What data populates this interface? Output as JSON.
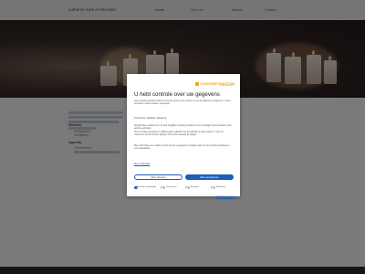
{
  "site": {
    "brand": "Lutherse Kerk Amsterdam",
    "nav": [
      "Home",
      "Over ons",
      "Nieuws",
      "Contact"
    ]
  },
  "content": {
    "section1": "Welkom",
    "section2": "Agenda",
    "links": [
      "Kerkdiensten",
      "Activiteiten",
      "Geschiedenis"
    ]
  },
  "consent": {
    "logo": "COOKIEINFORMATION",
    "logo_sub": "cookie compliance",
    "title": "U hebt controle over uw gegevens",
    "p1": "Onze website gebruikt cookies om de site goed te laten werken en om het gebruik te analyseren. U kunt zelf kiezen welke cookies u accepteert.",
    "p2": "Functioneel, Statistiek, Marketing",
    "p3": "Wij gebruiken cookies om u de best mogelijke ervaring te bieden en om te begrijpen hoe bezoekers onze website gebruiken.",
    "p4": "Door op 'Alles accepteren' te klikken gaat u akkoord met het gebruik van alle cookies. U kunt uw voorkeuren op elk moment wijzigen via de link onderaan de pagina.",
    "p5": "Meer informatie over cookies en hoe wij met uw gegevens omgaan vindt u in onze privacyverklaring en ons cookiebeleid.",
    "more": "Meer informatie",
    "deny": "Alles afwijzen",
    "accept": "Alles accepteren",
    "toggles": [
      {
        "label": "Strikt noodzakelijk",
        "on": true
      },
      {
        "label": "Functioneel",
        "on": false
      },
      {
        "label": "Statistiek",
        "on": false
      },
      {
        "label": "Marketing",
        "on": false
      }
    ],
    "prefs": "Details aanpassen"
  },
  "colors": {
    "accent": "#1a5fb4",
    "logo": "#f4a300"
  }
}
